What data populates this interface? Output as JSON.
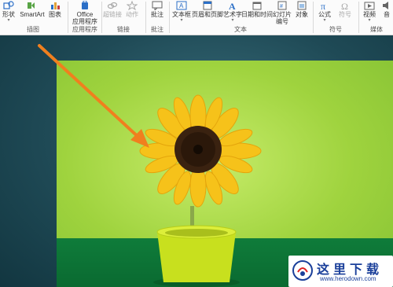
{
  "ribbon": {
    "illustrations": {
      "shapes_label": "形状",
      "smartart_label": "SmartArt",
      "chart_label": "图表",
      "group_label": "插图"
    },
    "apps": {
      "office_label_line1": "Office",
      "office_label_line2": "应用程序",
      "group_label": "应用程序"
    },
    "links": {
      "hyperlink_label": "超链接",
      "action_label": "动作",
      "group_label": "链接"
    },
    "comments": {
      "comment_label": "批注",
      "group_label": "批注"
    },
    "text": {
      "textbox_label": "文本框",
      "header_footer_label": "页眉和页脚",
      "wordart_label": "艺术字",
      "datetime_label": "日期和时间",
      "slide_number_line1": "幻灯片",
      "slide_number_line2": "编号",
      "object_label": "对象",
      "group_label": "文本"
    },
    "symbols": {
      "equation_label": "公式",
      "symbol_label": "符号",
      "group_label": "符号"
    },
    "media": {
      "video_label": "视频",
      "audio_label": "音",
      "group_label": "媒体"
    }
  },
  "watermark": {
    "title": "这里下载",
    "url": "www.herodown.com"
  },
  "colors": {
    "accent_blue": "#2b6fc7",
    "arrow_orange": "#f07f1e",
    "slide_bg": "#1f4a56"
  }
}
